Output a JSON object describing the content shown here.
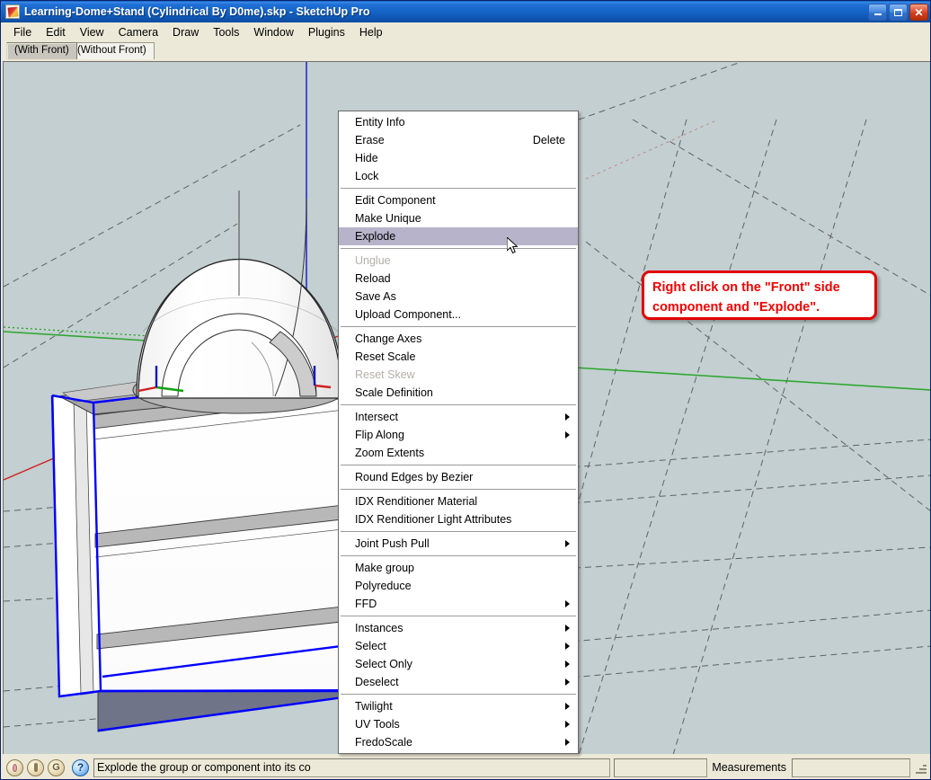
{
  "window": {
    "title": "Learning-Dome+Stand (Cylindrical By D0me).skp  - SketchUp Pro",
    "app_icon": "sketchup-pencil-icon",
    "controls": {
      "minimize": "minimize-button",
      "maximize": "maximize-button",
      "close": "✕"
    }
  },
  "menubar": {
    "items": [
      {
        "label": "File"
      },
      {
        "label": "Edit"
      },
      {
        "label": "View"
      },
      {
        "label": "Camera"
      },
      {
        "label": "Draw"
      },
      {
        "label": "Tools"
      },
      {
        "label": "Window"
      },
      {
        "label": "Plugins"
      },
      {
        "label": "Help"
      }
    ]
  },
  "scene_tabs": [
    {
      "label": "(With Front)",
      "active": true
    },
    {
      "label": "(Without Front)",
      "active": false
    }
  ],
  "callout": {
    "line1": "Right click on the \"Front\" side",
    "line2": "component and \"Explode\".",
    "border_color": "#e00000",
    "text_color": "#f00000"
  },
  "context_menu": {
    "highlight_color": "#b6b3ca",
    "groups": [
      {
        "items": [
          {
            "label": "Entity Info",
            "accel": "",
            "state": "normal",
            "submenu": false
          },
          {
            "label": "Erase",
            "accel": "Delete",
            "state": "normal",
            "submenu": false
          },
          {
            "label": "Hide",
            "accel": "",
            "state": "normal",
            "submenu": false
          },
          {
            "label": "Lock",
            "accel": "",
            "state": "normal",
            "submenu": false
          }
        ]
      },
      {
        "items": [
          {
            "label": "Edit Component",
            "accel": "",
            "state": "normal",
            "submenu": false
          },
          {
            "label": "Make Unique",
            "accel": "",
            "state": "normal",
            "submenu": false
          },
          {
            "label": "Explode",
            "accel": "",
            "state": "selected",
            "submenu": false
          }
        ]
      },
      {
        "items": [
          {
            "label": "Unglue",
            "accel": "",
            "state": "disabled",
            "submenu": false
          },
          {
            "label": "Reload",
            "accel": "",
            "state": "normal",
            "submenu": false
          },
          {
            "label": "Save As",
            "accel": "",
            "state": "normal",
            "submenu": false
          },
          {
            "label": "Upload Component...",
            "accel": "",
            "state": "normal",
            "submenu": false
          }
        ]
      },
      {
        "items": [
          {
            "label": "Change Axes",
            "accel": "",
            "state": "normal",
            "submenu": false
          },
          {
            "label": "Reset Scale",
            "accel": "",
            "state": "normal",
            "submenu": false
          },
          {
            "label": "Reset Skew",
            "accel": "",
            "state": "disabled",
            "submenu": false
          },
          {
            "label": "Scale Definition",
            "accel": "",
            "state": "normal",
            "submenu": false
          }
        ]
      },
      {
        "items": [
          {
            "label": "Intersect",
            "accel": "",
            "state": "normal",
            "submenu": true
          },
          {
            "label": "Flip Along",
            "accel": "",
            "state": "normal",
            "submenu": true
          },
          {
            "label": "Zoom Extents",
            "accel": "",
            "state": "normal",
            "submenu": false
          }
        ]
      },
      {
        "items": [
          {
            "label": "Round Edges by Bezier",
            "accel": "",
            "state": "normal",
            "submenu": false
          }
        ]
      },
      {
        "items": [
          {
            "label": "IDX Renditioner Material",
            "accel": "",
            "state": "normal",
            "submenu": false
          },
          {
            "label": "IDX Renditioner Light Attributes",
            "accel": "",
            "state": "normal",
            "submenu": false
          }
        ]
      },
      {
        "items": [
          {
            "label": "Joint Push Pull",
            "accel": "",
            "state": "normal",
            "submenu": true
          }
        ]
      },
      {
        "items": [
          {
            "label": "Make group",
            "accel": "",
            "state": "normal",
            "submenu": false
          },
          {
            "label": "Polyreduce",
            "accel": "",
            "state": "normal",
            "submenu": false
          },
          {
            "label": "FFD",
            "accel": "",
            "state": "normal",
            "submenu": true
          }
        ]
      },
      {
        "items": [
          {
            "label": "Instances",
            "accel": "",
            "state": "normal",
            "submenu": true
          },
          {
            "label": "Select",
            "accel": "",
            "state": "normal",
            "submenu": true
          },
          {
            "label": "Select Only",
            "accel": "",
            "state": "normal",
            "submenu": true
          },
          {
            "label": "Deselect",
            "accel": "",
            "state": "normal",
            "submenu": true
          }
        ]
      },
      {
        "items": [
          {
            "label": "Twilight",
            "accel": "",
            "state": "normal",
            "submenu": true
          },
          {
            "label": "UV Tools",
            "accel": "",
            "state": "normal",
            "submenu": true
          },
          {
            "label": "FredoScale",
            "accel": "",
            "state": "normal",
            "submenu": true
          }
        ]
      }
    ]
  },
  "statusbar": {
    "icons": [
      "location-pin-icon",
      "person-icon",
      "google-g-icon",
      "help-question-icon"
    ],
    "hint_text": "Explode the group or component into its co",
    "measurements_label": "Measurements",
    "measurements_value": ""
  },
  "viewport": {
    "background_color": "#c3cfd0",
    "axis_colors": {
      "red": "#d02020",
      "green": "#12a012",
      "blue": "#1414c8"
    },
    "selection_color": "#0000ff",
    "model_name": "dome-and-stand-model"
  }
}
